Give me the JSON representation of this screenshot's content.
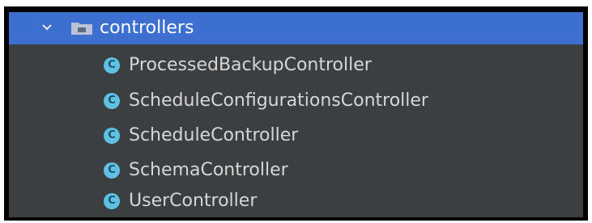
{
  "tree": {
    "folder": {
      "name": "controllers",
      "expanded": true,
      "icon": "folder-icon",
      "selected": true
    },
    "items": [
      {
        "label": "ProcessedBackupController",
        "icon": "class-icon",
        "icon_letter": "C"
      },
      {
        "label": "ScheduleConfigurationsController",
        "icon": "class-icon",
        "icon_letter": "C"
      },
      {
        "label": "ScheduleController",
        "icon": "class-icon",
        "icon_letter": "C"
      },
      {
        "label": "SchemaController",
        "icon": "class-icon",
        "icon_letter": "C"
      },
      {
        "label": "UserController",
        "icon": "class-icon",
        "icon_letter": "C"
      }
    ]
  },
  "colors": {
    "panel_background": "#3c3f41",
    "selection": "#3d6fd1",
    "class_icon": "#5ec1e2",
    "text": "#d6d6d6"
  }
}
